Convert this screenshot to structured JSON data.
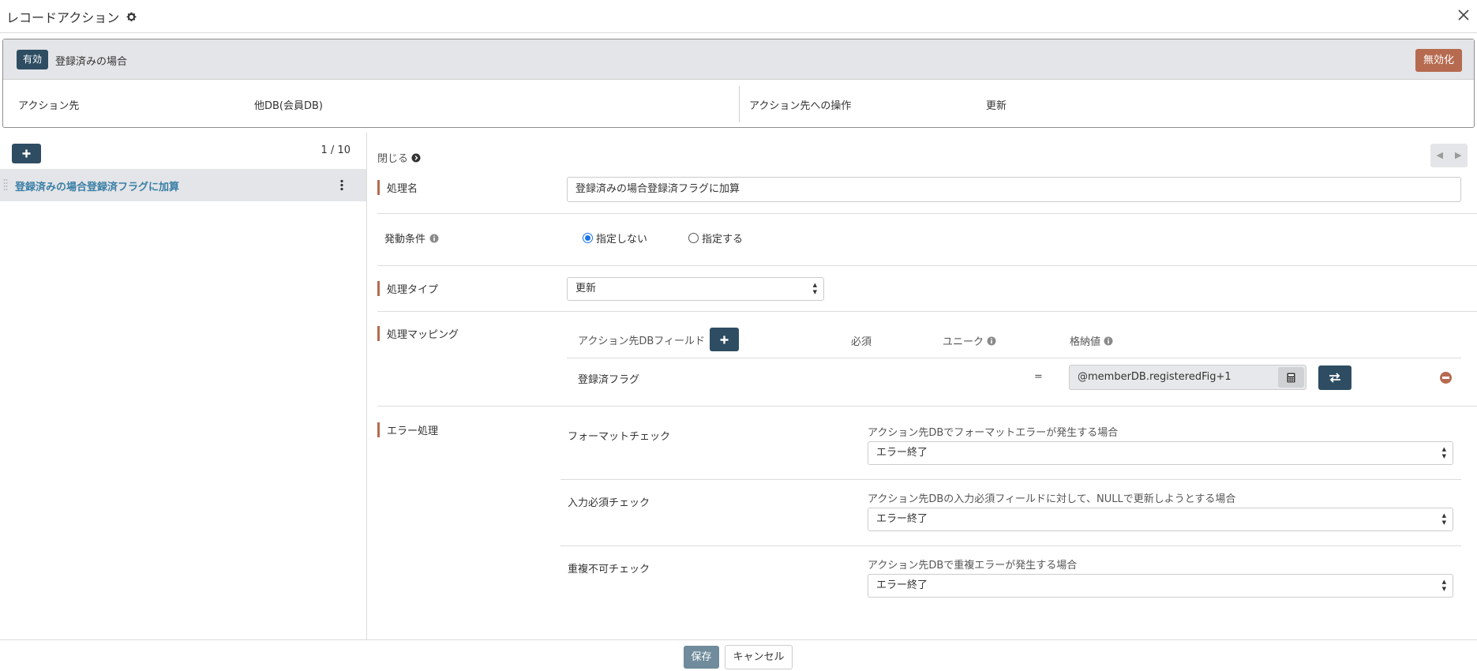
{
  "modal": {
    "title": "レコードアクション"
  },
  "summary": {
    "status_badge": "有効",
    "title": "登録済みの場合",
    "disable_button": "無効化",
    "target_label": "アクション先",
    "target_value": "他DB(会員DB)",
    "operation_label": "アクション先への操作",
    "operation_value": "更新"
  },
  "list": {
    "count": "1 / 10",
    "items": [
      {
        "label": "登録済みの場合登録済フラグに加算"
      }
    ]
  },
  "detail": {
    "close_label": "閉じる",
    "name_label": "処理名",
    "name_value": "登録済みの場合登録済フラグに加算",
    "condition_label": "発動条件",
    "condition_options": [
      {
        "label": "指定しない",
        "checked": true
      },
      {
        "label": "指定する",
        "checked": false
      }
    ],
    "type_label": "処理タイプ",
    "type_value": "更新",
    "mapping_label": "処理マッピング",
    "mapping_headers": {
      "field": "アクション先DBフィールド",
      "required": "必須",
      "unique": "ユニーク",
      "value": "格納値"
    },
    "mapping_rows": [
      {
        "field": "登録済フラグ",
        "operator": "=",
        "value": "@memberDB.registeredFig+1"
      }
    ],
    "error_label": "エラー処理",
    "error_checks": [
      {
        "label": "フォーマットチェック",
        "description": "アクション先DBでフォーマットエラーが発生する場合",
        "value": "エラー終了"
      },
      {
        "label": "入力必須チェック",
        "description": "アクション先DBの入力必須フィールドに対して、NULLで更新しようとする場合",
        "value": "エラー終了"
      },
      {
        "label": "重複不可チェック",
        "description": "アクション先DBで重複エラーが発生する場合",
        "value": "エラー終了"
      }
    ]
  },
  "footer": {
    "save": "保存",
    "cancel": "キャンセル"
  },
  "colors": {
    "primary": "#2e4d62",
    "danger": "#b66a50",
    "link": "#3a7fa6",
    "header_bg": "#e4e5e8"
  },
  "icons": {
    "settings": "gear-icon",
    "close": "close-icon",
    "add": "plus-icon",
    "menu": "kebab-icon",
    "info": "info-icon",
    "calculator": "calculator-icon",
    "swap": "swap-icon",
    "remove": "minus-circle-icon"
  }
}
